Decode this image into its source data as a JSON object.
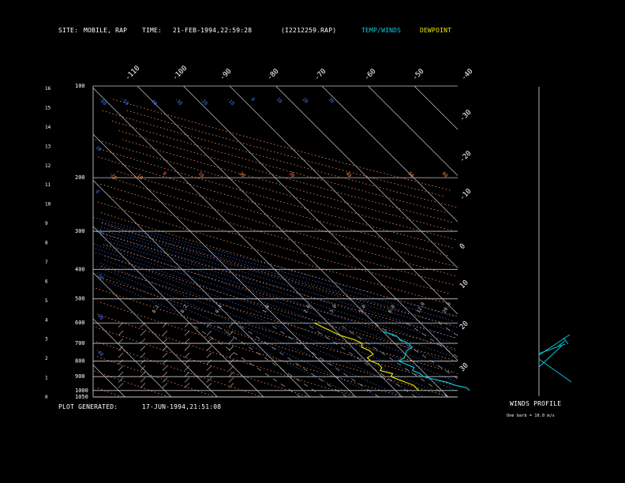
{
  "header": {
    "site_label": "SITE:",
    "site_value": "MOBILE, RAP",
    "time_label": "TIME:",
    "time_value": "21-FEB-1994,22:59:28",
    "file": "(I2212259.RAP)",
    "legend_temp": "TEMP/WINDS",
    "legend_dew": "DEWPOINT"
  },
  "footer": {
    "plot_label": "PLOT GENERATED:",
    "plot_value": "17-JUN-1994,21:51:08"
  },
  "wind_panel": {
    "title": "WINDS PROFILE",
    "note": "One barb = 10.0 m/s"
  },
  "colors": {
    "temp": "#00c8d8",
    "dewpoint": "#e8e000",
    "isotherm": "#c8c8c8",
    "dry_adiabat": "#ff8a50",
    "moist_adiabat": "#4a7dff",
    "mixing_ratio": "#c8c8c8",
    "isobar": "#c8c8c8"
  },
  "chart_data": {
    "type": "line",
    "title": "",
    "pressure_axis": {
      "labels": [
        "100",
        "200",
        "300",
        "400",
        "500",
        "600",
        "700",
        "800",
        "900",
        "1000",
        "1050"
      ],
      "values": [
        100,
        200,
        300,
        400,
        500,
        600,
        700,
        800,
        900,
        1000,
        1050
      ]
    },
    "height_axis": {
      "labels": [
        "16",
        "15",
        "14",
        "13",
        "12",
        "11",
        "10",
        "9",
        "8",
        "7",
        "6",
        "5",
        "4",
        "3",
        "2",
        "1",
        "0"
      ],
      "values": [
        16,
        15,
        14,
        13,
        12,
        11,
        10,
        9,
        8,
        7,
        6,
        5,
        4,
        3,
        2,
        1,
        0
      ]
    },
    "isotherm_labels_top": [
      "-110",
      "-100",
      "-90",
      "-80",
      "-70",
      "-60",
      "-50",
      "-40"
    ],
    "isotherm_labels_right": [
      "-30",
      "-20",
      "-10",
      "0",
      "10",
      "20",
      "30"
    ],
    "moist_adiabat_labels": [
      "-60",
      "-50",
      "-40",
      "-30",
      "-20",
      "-10",
      "0",
      "10",
      "20",
      "30"
    ],
    "moist_adiabat_labels_left": [
      "10",
      "0",
      "-10",
      "-20",
      "-30",
      "-40"
    ],
    "dry_adiabat_labels": [
      "-20",
      "-10",
      "0",
      "10",
      "20",
      "30",
      "40",
      "50",
      "60"
    ],
    "mixing_ratio_labels": [
      "0.1",
      "0.2",
      "0.4",
      "1.0",
      "2.0",
      "3.0",
      "5.0",
      "8.0",
      "12.0",
      "20.0"
    ],
    "series": [
      {
        "name": "TEMP/WINDS",
        "values": [
          [
            1000,
            -14
          ],
          [
            980,
            -14
          ],
          [
            960,
            -16
          ],
          [
            940,
            -17
          ],
          [
            920,
            -19
          ],
          [
            900,
            -21
          ],
          [
            880,
            -21
          ],
          [
            860,
            -22
          ],
          [
            840,
            -21
          ],
          [
            820,
            -22
          ],
          [
            800,
            -23
          ],
          [
            780,
            -21
          ],
          [
            760,
            -20
          ],
          [
            740,
            -19
          ],
          [
            720,
            -17
          ],
          [
            700,
            -17
          ],
          [
            680,
            -18
          ],
          [
            660,
            -18
          ],
          [
            640,
            -20
          ]
        ]
      },
      {
        "name": "DEWPOINT",
        "values": [
          [
            1000,
            -25
          ],
          [
            980,
            -25
          ],
          [
            960,
            -25
          ],
          [
            940,
            -26
          ],
          [
            920,
            -27
          ],
          [
            900,
            -28
          ],
          [
            880,
            -27
          ],
          [
            860,
            -29
          ],
          [
            840,
            -28
          ],
          [
            820,
            -28
          ],
          [
            800,
            -29
          ],
          [
            780,
            -29
          ],
          [
            760,
            -27
          ],
          [
            740,
            -27
          ],
          [
            720,
            -28
          ],
          [
            700,
            -27
          ],
          [
            680,
            -28
          ],
          [
            660,
            -30
          ],
          [
            640,
            -31
          ],
          [
            620,
            -32
          ],
          [
            600,
            -33
          ]
        ]
      }
    ]
  }
}
